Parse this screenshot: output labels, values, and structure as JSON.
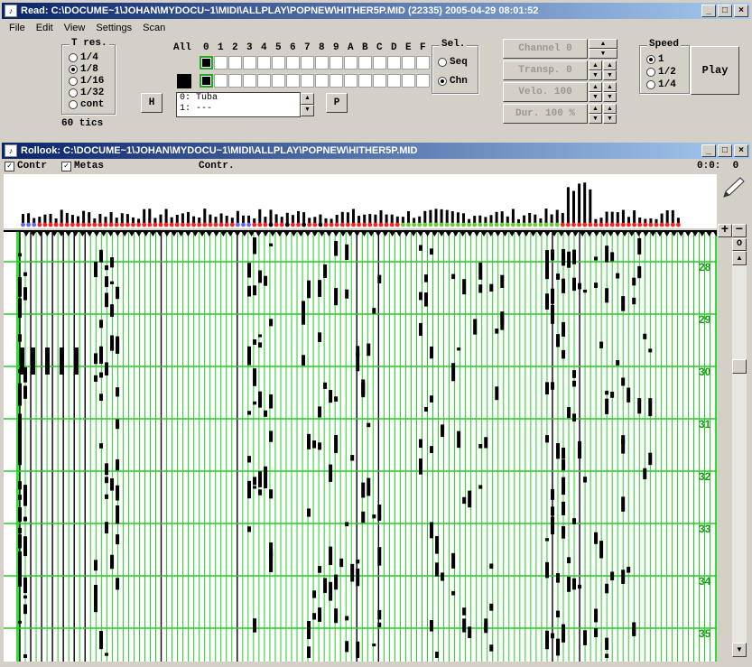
{
  "read_window": {
    "title": "Read: C:\\DOCUME~1\\JOHAN\\MYDOCU~1\\MIDI\\ALLPLAY\\POPNEW\\HITHER5P.MID (22335) 2005-04-29 08:01:52",
    "menu": [
      "File",
      "Edit",
      "View",
      "Settings",
      "Scan"
    ],
    "tres": {
      "legend": "T res.",
      "options": [
        "1/4",
        "1/8",
        "1/16",
        "1/32",
        "cont"
      ],
      "selected": 1,
      "tics": "60 tics"
    },
    "channels": {
      "all_label": "All",
      "labels": [
        "0",
        "1",
        "2",
        "3",
        "4",
        "5",
        "6",
        "7",
        "8",
        "9",
        "A",
        "B",
        "C",
        "D",
        "E",
        "F"
      ],
      "active": 0
    },
    "h_button": "H",
    "p_button": "P",
    "instrument_list": [
      "0: Tuba",
      "1: ---"
    ],
    "sel": {
      "legend": "Sel.",
      "options": [
        "Seq",
        "Chn"
      ],
      "selected": 1
    },
    "params": {
      "channel": "Channel  0",
      "transp": "Transp.  0",
      "velo": "Velo. 100",
      "dur": "Dur. 100 %"
    },
    "speed": {
      "legend": "Speed",
      "options": [
        "1",
        "1/2",
        "1/4"
      ],
      "selected": 0
    },
    "play_button": "Play"
  },
  "rollook_window": {
    "title": "Rollook: C:\\DOCUME~1\\JOHAN\\MYDOCU~1\\MIDI\\ALLPLAY\\POPNEW\\HITHER5P.MID",
    "contr_check": {
      "label": "Contr",
      "checked": true
    },
    "metas_check": {
      "label": "Metas",
      "checked": true
    },
    "contr_label": "Contr.",
    "position": "0:0:  0",
    "zoom_plus": "+",
    "zoom_minus": "−",
    "zoom_o": "O",
    "measure_labels": [
      "28",
      "29",
      "30",
      "31",
      "32",
      "33",
      "34",
      "35"
    ],
    "colors": {
      "grid_green": "#22cc22",
      "measure_label": "#1a9a1a",
      "note": "#000000",
      "marker_red": "#ff2020",
      "marker_green": "#66cc33",
      "marker_blue": "#6666ff"
    }
  }
}
